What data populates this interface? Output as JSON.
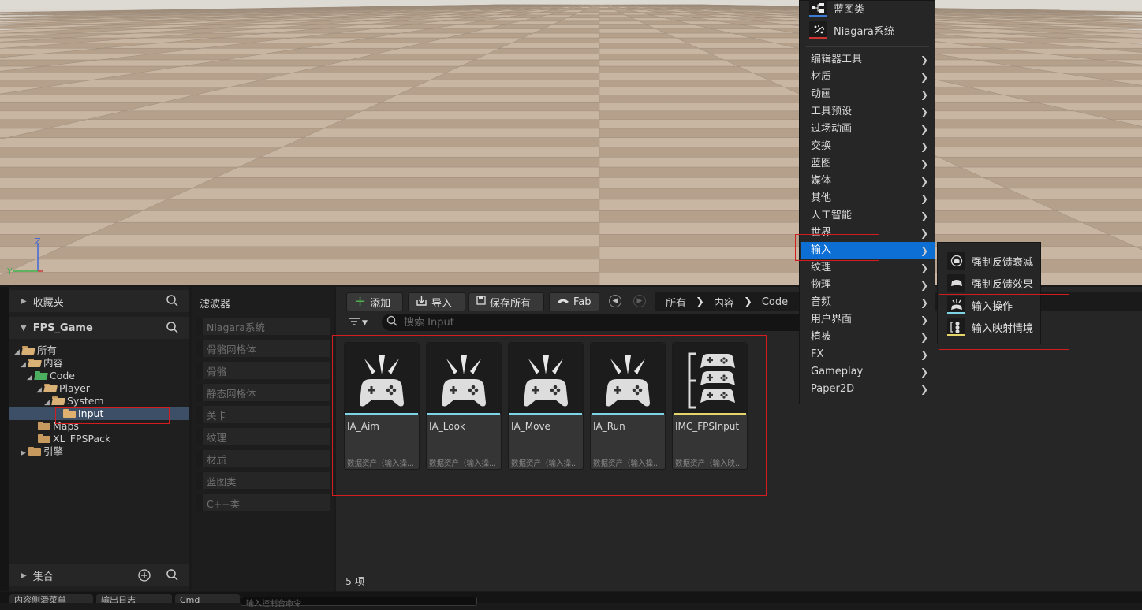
{
  "viewport": {
    "axis_z": "Z",
    "axis_y": "Y"
  },
  "colors": {
    "accent": "#0d6fd3",
    "highlight": "#d21c20",
    "input_action": "#7fd3e6",
    "input_mapping": "#e6d56a"
  },
  "left_panel": {
    "favorites": "收藏夹",
    "project": "FPS_Game",
    "tree": {
      "all": "所有",
      "content": "内容",
      "code": "Code",
      "player": "Player",
      "system": "System",
      "input": "Input",
      "maps": "Maps",
      "xl": "XL_FPSPack",
      "engine": "引擎"
    },
    "collections": "集合"
  },
  "filters": {
    "title": "滤波器",
    "items": [
      "Niagara系统",
      "骨骼网格体",
      "骨骼",
      "静态网格体",
      "关卡",
      "纹理",
      "材质",
      "蓝图类",
      "C++类"
    ]
  },
  "toolbar": {
    "add": "添加",
    "import": "导入",
    "save_all": "保存所有",
    "fab": "Fab"
  },
  "breadcrumbs": [
    "所有",
    "内容",
    "Code"
  ],
  "search": {
    "placeholder": "搜索 Input"
  },
  "assets": [
    {
      "name": "IA_Aim",
      "type": "数据资产（输入操...",
      "icon": "gamepad-action-icon"
    },
    {
      "name": "IA_Look",
      "type": "数据资产（输入操...",
      "icon": "gamepad-action-icon"
    },
    {
      "name": "IA_Move",
      "type": "数据资产（输入操...",
      "icon": "gamepad-action-icon"
    },
    {
      "name": "IA_Run",
      "type": "数据资产（输入操...",
      "icon": "gamepad-action-icon"
    },
    {
      "name": "IMC_FPSInput",
      "type": "数据资产（输入映...",
      "icon": "gamepad-mapping-icon"
    }
  ],
  "item_count": "5 项",
  "context_menu": {
    "top_entries": [
      "蓝图类",
      "Niagara系统"
    ],
    "items": [
      "编辑器工具",
      "材质",
      "动画",
      "工具预设",
      "过场动画",
      "交换",
      "蓝图",
      "媒体",
      "其他",
      "人工智能",
      "世界",
      "输入",
      "纹理",
      "物理",
      "音频",
      "用户界面",
      "植被",
      "FX",
      "Gameplay",
      "Paper2D"
    ],
    "active": "输入"
  },
  "sub_menu": {
    "items": [
      "强制反馈衰减",
      "强制反馈效果",
      "输入操作",
      "输入映射情境"
    ]
  },
  "bottom": {
    "tab1": "内容侧滑菜单",
    "tab2": "输出日志",
    "tab3": "Cmd",
    "console_placeholder": "输入控制台命令"
  }
}
